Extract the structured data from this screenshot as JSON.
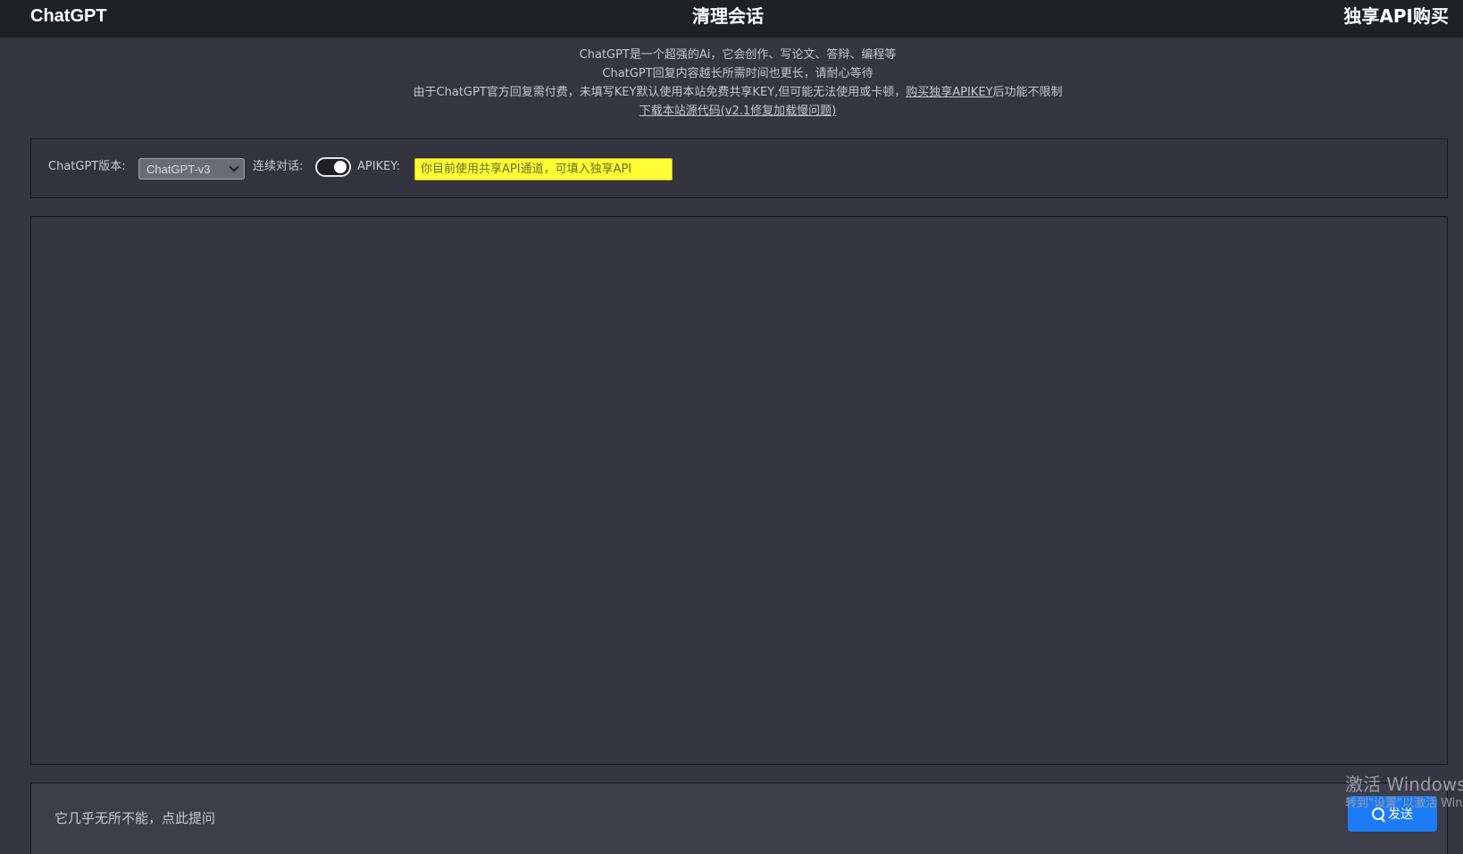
{
  "header": {
    "brand": "ChatGPT",
    "clear_label": "清理会话",
    "buy_label": "独享API购买"
  },
  "intro": {
    "line1": "ChatGPT是一个超强的Ai，它会创作、写论文、答辩、编程等",
    "line2": "ChatGPT回复内容越长所需时间也更长，请耐心等待",
    "line3_prefix": "由于ChatGPT官方回复需付费，未填写KEY默认使用本站免费共享KEY,但可能无法使用或卡顿，",
    "line3_link": "购买独享APIKEY",
    "line3_suffix": "后功能不限制",
    "line4_link": "下载本站源代码(v2.1修复加载慢问题)"
  },
  "settings": {
    "version_label": "ChatGPT版本:",
    "version_value": "ChatGPT-v3",
    "continuous_label": "连续对话:",
    "continuous_on": true,
    "apikey_label": "APIKEY:",
    "apikey_placeholder": "你目前使用共享API通道，可填入独享API",
    "apikey_bg_color": "#ffff33"
  },
  "composer": {
    "placeholder": "它几乎无所不能，点此提问",
    "send_label": "发送",
    "send_color": "#1b7cf4"
  },
  "watermark": {
    "title": "激活 Windows",
    "subtitle": "转到\"设置\"以激活 Windows。"
  }
}
